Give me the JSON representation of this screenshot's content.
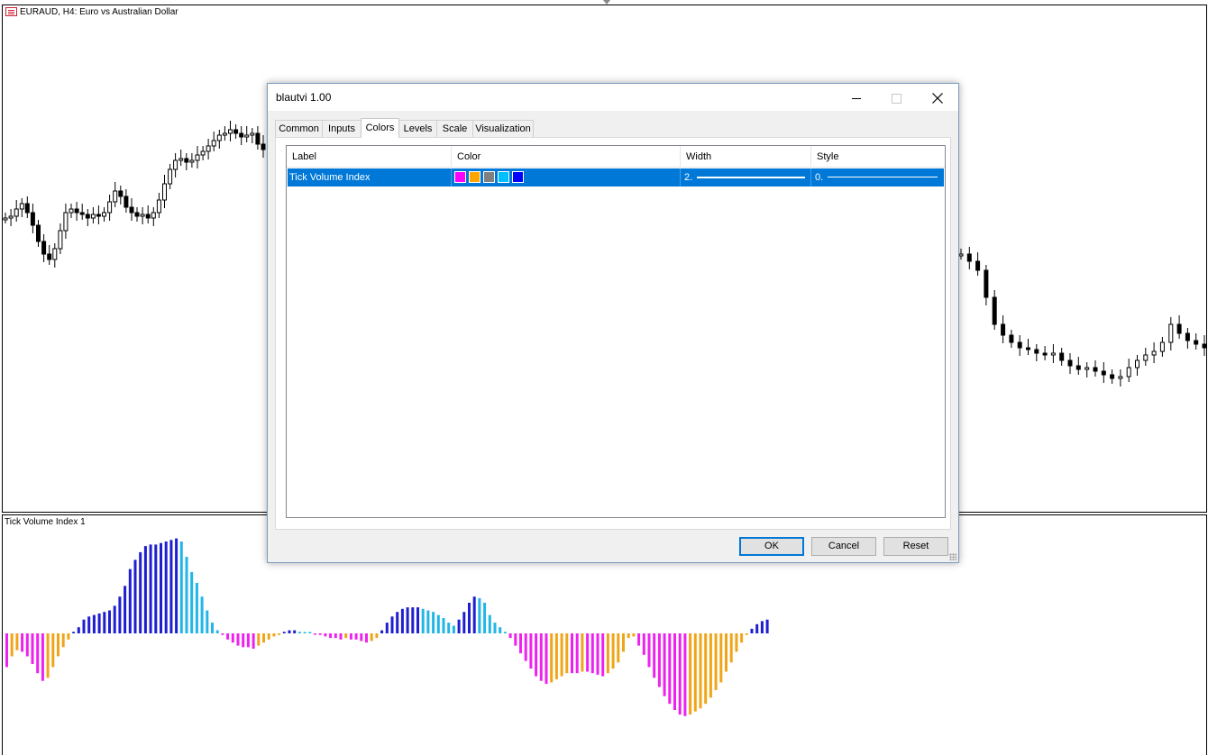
{
  "chart": {
    "title": "EURAUD, H4:  Euro vs Australian Dollar",
    "indicator_title": "Tick Volume Index 1"
  },
  "dialog": {
    "title": "blautvi 1.00",
    "tabs": [
      {
        "label": "Common"
      },
      {
        "label": "Inputs"
      },
      {
        "label": "Colors"
      },
      {
        "label": "Levels"
      },
      {
        "label": "Scale"
      },
      {
        "label": "Visualization"
      }
    ],
    "active_tab": "Colors",
    "columns": {
      "label": "Label",
      "color": "Color",
      "width": "Width",
      "style": "Style"
    },
    "rows": [
      {
        "label": "Tick Volume Index",
        "colors": [
          "#ff00ff",
          "#ffa500",
          "#808080",
          "#00bfff",
          "#0000ff"
        ],
        "width": "2.",
        "style": "0."
      }
    ],
    "buttons": {
      "ok": "OK",
      "cancel": "Cancel",
      "reset": "Reset"
    }
  },
  "colors": {
    "selection": "#0078d7",
    "magenta": "#ee22ee",
    "orange": "#f0a518",
    "blue": "#1f1fd0",
    "sky": "#22b5e8"
  },
  "indicator_values": [
    -44,
    -30,
    -22,
    -24,
    -30,
    -40,
    -52,
    -62,
    -58,
    -44,
    -30,
    -18,
    -8,
    2,
    8,
    18,
    22,
    24,
    26,
    28,
    30,
    36,
    48,
    62,
    84,
    96,
    106,
    114,
    116,
    116,
    118,
    120,
    122,
    124,
    120,
    100,
    80,
    66,
    48,
    30,
    14,
    4,
    -2,
    -8,
    -12,
    -16,
    -18,
    -18,
    -20,
    -16,
    -12,
    -8,
    -4,
    -2,
    2,
    4,
    4,
    2,
    1,
    0,
    -1,
    -2,
    -4,
    -6,
    -6,
    -8,
    -6,
    -8,
    -8,
    -10,
    -12,
    -10,
    -6,
    4,
    14,
    22,
    28,
    32,
    34,
    34,
    34,
    32,
    30,
    28,
    24,
    20,
    14,
    10,
    18,
    28,
    40,
    48,
    46,
    40,
    24,
    14,
    8,
    2,
    -6,
    -16,
    -26,
    -36,
    -46,
    -56,
    -62,
    -66,
    -64,
    -60,
    -56,
    -52,
    -52,
    -52,
    -50,
    -50,
    -52,
    -54,
    -56,
    -52,
    -46,
    -38,
    -24,
    -6,
    -4,
    -16,
    -28,
    -44,
    -58,
    -70,
    -82,
    -92,
    -100,
    -106,
    -108,
    -106,
    -102,
    -98,
    -92,
    -84,
    -74,
    -64,
    -50,
    -38,
    -24,
    -12,
    -2,
    6,
    12,
    16,
    18
  ]
}
